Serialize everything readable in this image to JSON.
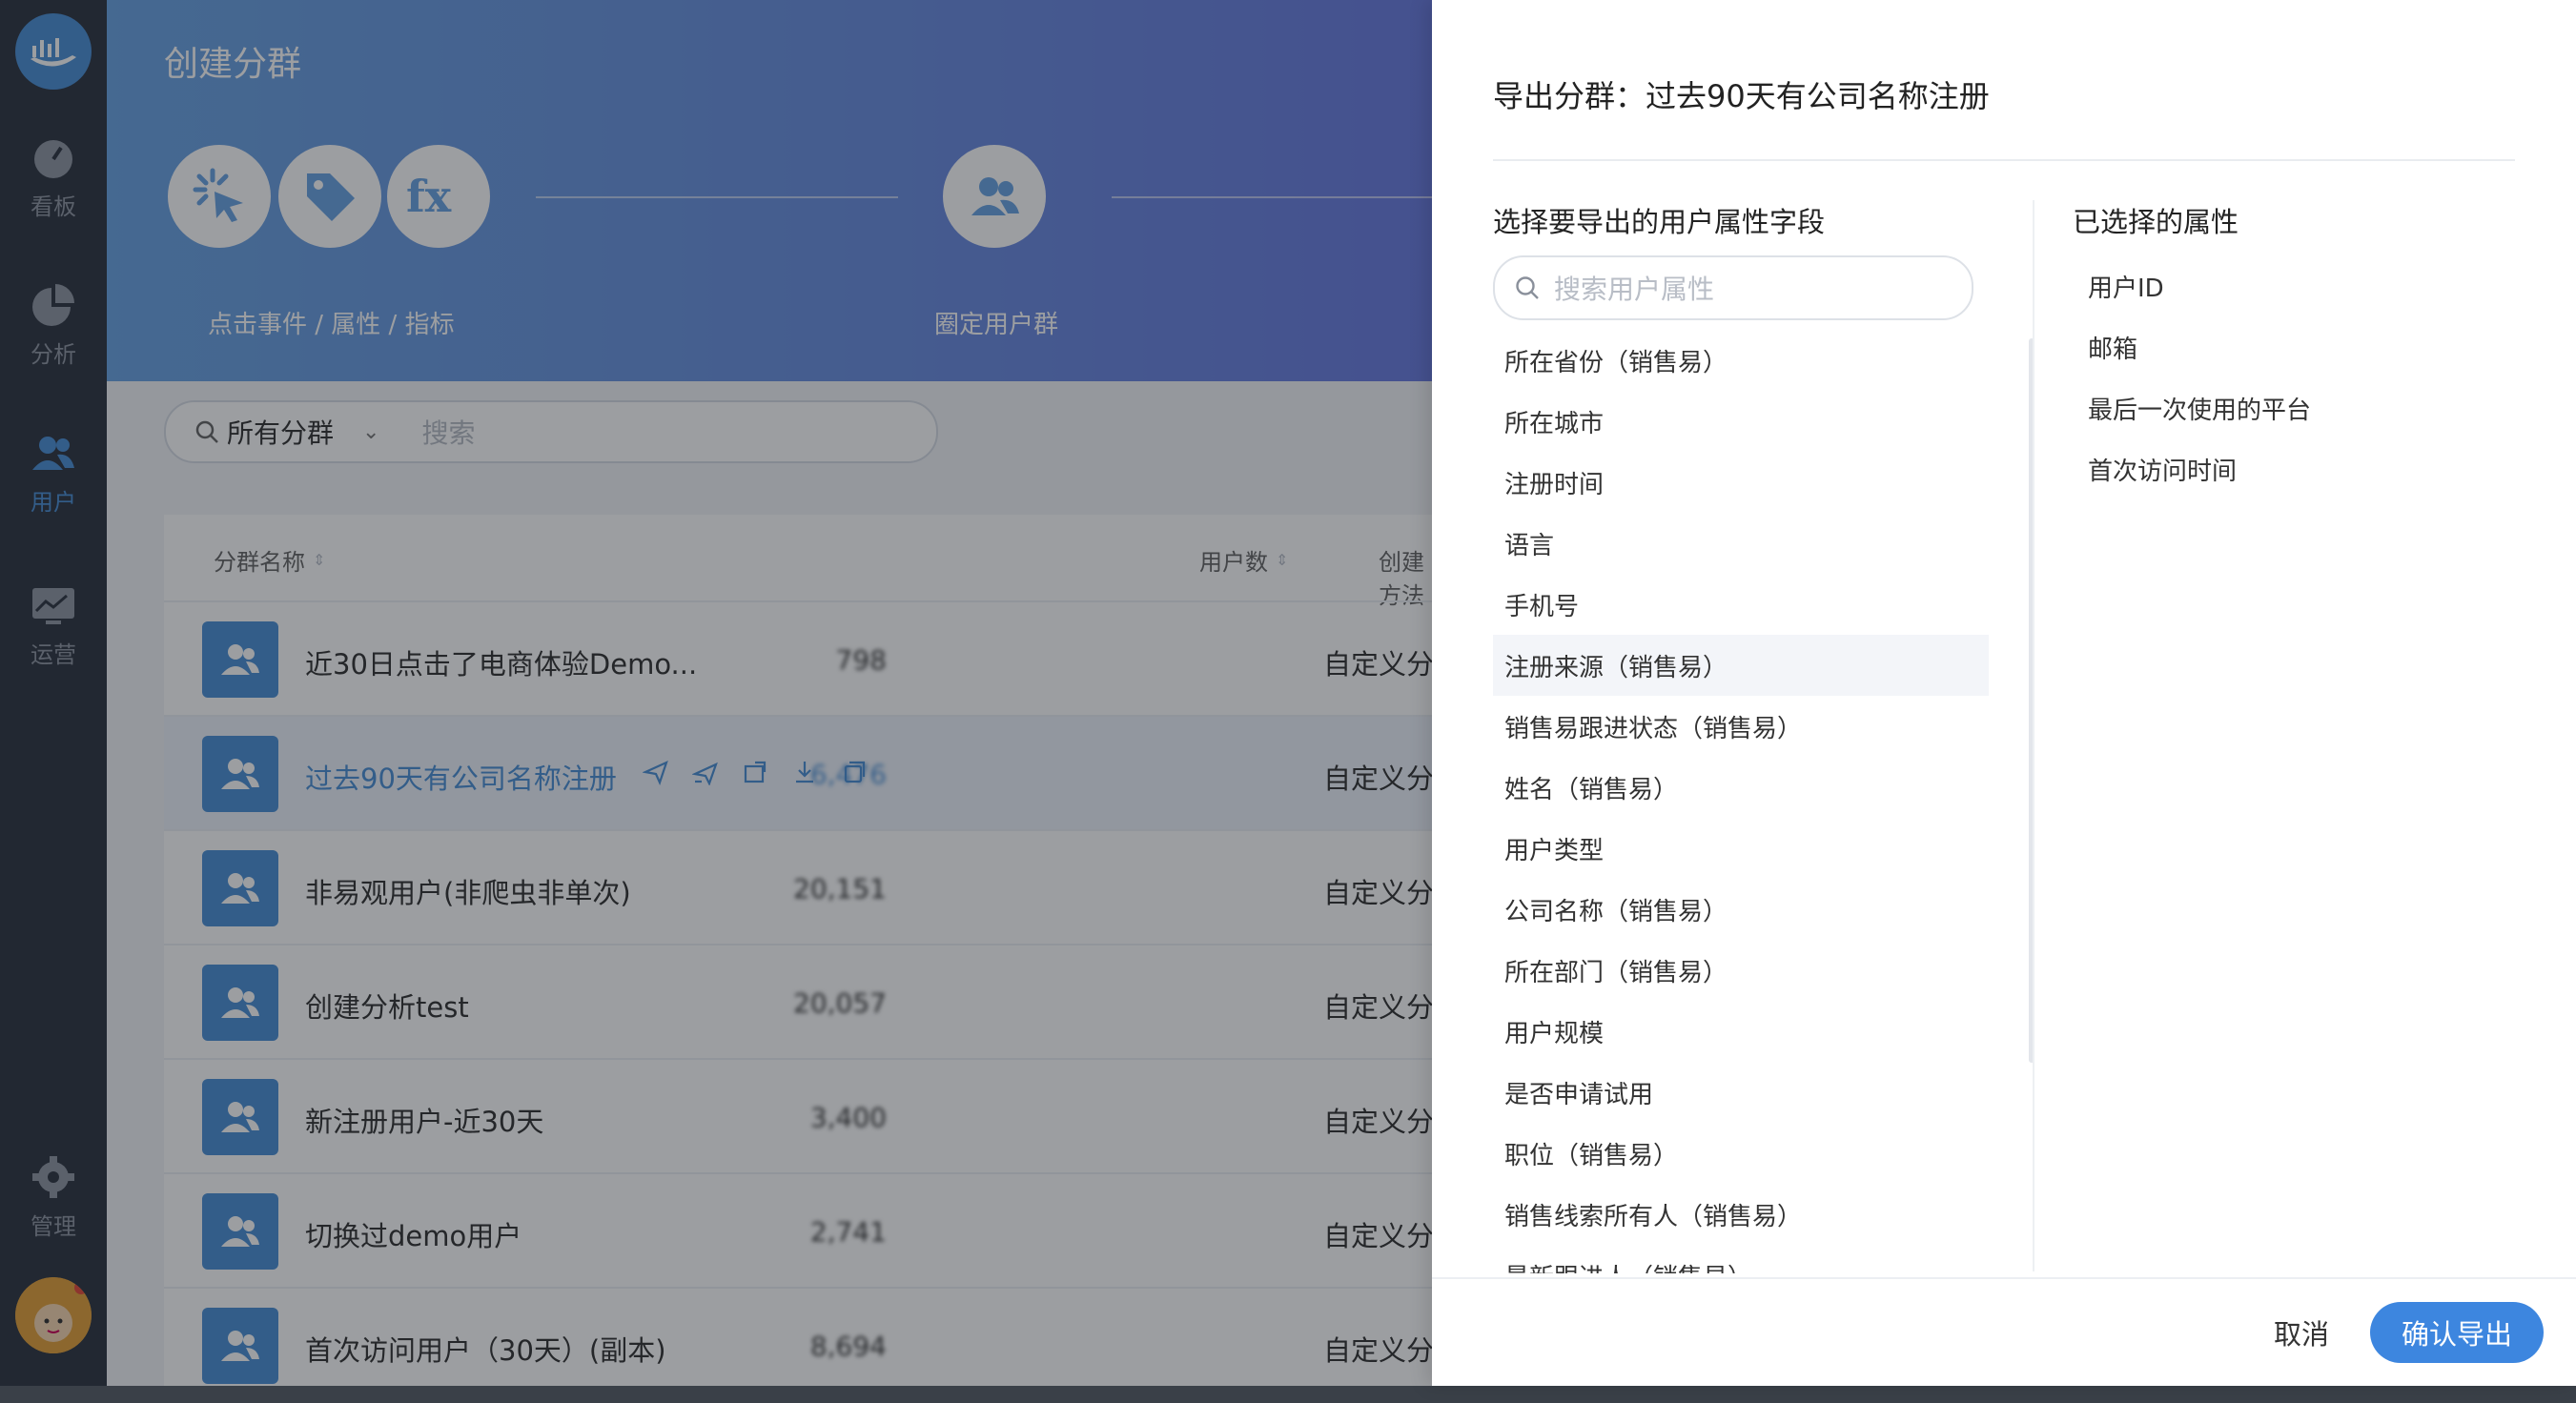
{
  "nav": {
    "items": [
      {
        "label": "看板",
        "icon": "dashboard-icon"
      },
      {
        "label": "分析",
        "icon": "pie-chart-icon"
      },
      {
        "label": "用户",
        "icon": "users-icon"
      },
      {
        "label": "运营",
        "icon": "operation-icon"
      }
    ],
    "manage_label": "管理"
  },
  "page": {
    "title": "创建分群",
    "steps": [
      {
        "label": "点击事件 / 属性 / 指标"
      },
      {
        "label": "圈定用户群"
      }
    ],
    "filter": {
      "select_value": "所有分群",
      "placeholder": "搜索"
    },
    "table": {
      "columns": [
        "分群名称",
        "用户数",
        "创建方法"
      ],
      "rows": [
        {
          "name": "近30日点击了电商体验Demo...",
          "count": "798",
          "method": "自定义分群"
        },
        {
          "name": "过去90天有公司名称注册",
          "count": "6,476",
          "method": "自定义分群"
        },
        {
          "name": "非易观用户(非爬虫非单次)",
          "count": "20,151",
          "method": "自定义分群"
        },
        {
          "name": "创建分析test",
          "count": "20,057",
          "method": "自定义分群"
        },
        {
          "name": "新注册用户-近30天",
          "count": "3,400",
          "method": "自定义分群"
        },
        {
          "name": "切换过demo用户",
          "count": "2,741",
          "method": "自定义分群"
        },
        {
          "name": "首次访问用户（30天）(副本)",
          "count": "8,694",
          "method": "自定义分群"
        }
      ]
    }
  },
  "drawer": {
    "title": "导出分群：过去90天有公司名称注册",
    "left_heading": "选择要导出的用户属性字段",
    "search_placeholder": "搜索用户属性",
    "attributes": [
      "所在省份（销售易）",
      "所在城市",
      "注册时间",
      "语言",
      "手机号",
      "注册来源（销售易）",
      "销售易跟进状态（销售易）",
      "姓名（销售易）",
      "用户类型",
      "公司名称（销售易）",
      "所在部门（销售易）",
      "用户规模",
      "是否申请试用",
      "职位（销售易）",
      "销售线索所有人（销售易）",
      "最新跟进人（销售易）"
    ],
    "right_heading": "已选择的属性",
    "selected": [
      "用户ID",
      "邮箱",
      "最后一次使用的平台",
      "首次访问时间"
    ],
    "cancel_label": "取消",
    "confirm_label": "确认导出"
  },
  "colors": {
    "accent": "#3d86df",
    "nav_bg": "#2e3440",
    "hero_start": "#6aa4e3",
    "hero_end": "#6a7be0"
  }
}
